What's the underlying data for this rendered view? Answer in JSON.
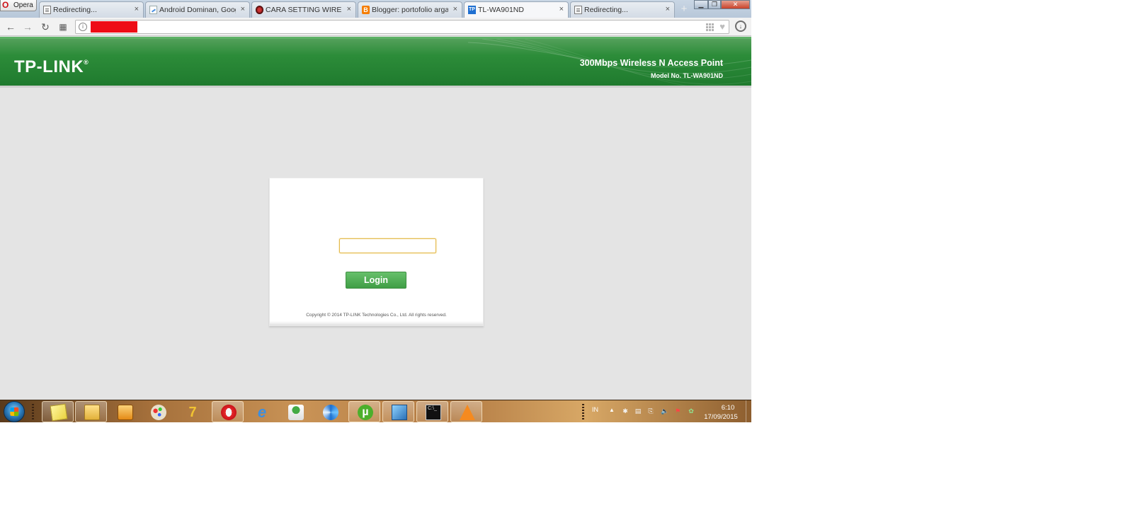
{
  "browser": {
    "menu_label": "Opera",
    "tabs": [
      {
        "label": "Redirecting...",
        "icon": "document-icon"
      },
      {
        "label": "Android Dominan, Google",
        "icon": "google-icon"
      },
      {
        "label": "CARA SETTING WIRELESS",
        "icon": "site-icon"
      },
      {
        "label": "Blogger: portofolio arga y",
        "icon": "blogger-icon"
      },
      {
        "label": "TL-WA901ND",
        "icon": "tplink-icon",
        "active": true
      },
      {
        "label": "Redirecting...",
        "icon": "document-icon"
      }
    ],
    "tab_close_glyph": "×",
    "new_tab_glyph": "+",
    "address": ""
  },
  "header": {
    "logo_text": "TP-LINK",
    "logo_mark": "®",
    "product_name": "300Mbps Wireless N Access Point",
    "model_no": "Model No. TL-WA901ND"
  },
  "login": {
    "password_value": "",
    "button_label": "Login",
    "copyright": "Copyright © 2014 TP-LINK Technologies Co., Ltd. All rights reserved."
  },
  "taskbar": {
    "apps": [
      "sticky-notes",
      "file-explorer",
      "media-player",
      "paint",
      "seven-zip-tool",
      "opera",
      "internet-explorer",
      "network-tool",
      "skype-like",
      "utorrent",
      "control-panel",
      "command-prompt",
      "vlc"
    ],
    "tray_lang": "IN",
    "clock_time": "6:10",
    "clock_date": "17/09/2015"
  },
  "colors": {
    "header_green": "#2c8c39",
    "login_green": "#4fae55",
    "redaction_red": "#ee0c16",
    "page_bg": "#e4e4e4"
  }
}
